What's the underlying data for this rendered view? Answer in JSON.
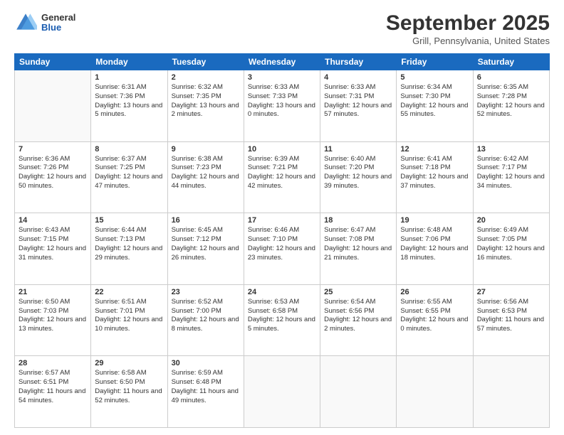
{
  "header": {
    "logo": {
      "general": "General",
      "blue": "Blue"
    },
    "title": "September 2025",
    "location": "Grill, Pennsylvania, United States"
  },
  "weekdays": [
    "Sunday",
    "Monday",
    "Tuesday",
    "Wednesday",
    "Thursday",
    "Friday",
    "Saturday"
  ],
  "weeks": [
    [
      {
        "day": "",
        "empty": true
      },
      {
        "day": "1",
        "sunrise": "Sunrise: 6:31 AM",
        "sunset": "Sunset: 7:36 PM",
        "daylight": "Daylight: 13 hours and 5 minutes."
      },
      {
        "day": "2",
        "sunrise": "Sunrise: 6:32 AM",
        "sunset": "Sunset: 7:35 PM",
        "daylight": "Daylight: 13 hours and 2 minutes."
      },
      {
        "day": "3",
        "sunrise": "Sunrise: 6:33 AM",
        "sunset": "Sunset: 7:33 PM",
        "daylight": "Daylight: 13 hours and 0 minutes."
      },
      {
        "day": "4",
        "sunrise": "Sunrise: 6:33 AM",
        "sunset": "Sunset: 7:31 PM",
        "daylight": "Daylight: 12 hours and 57 minutes."
      },
      {
        "day": "5",
        "sunrise": "Sunrise: 6:34 AM",
        "sunset": "Sunset: 7:30 PM",
        "daylight": "Daylight: 12 hours and 55 minutes."
      },
      {
        "day": "6",
        "sunrise": "Sunrise: 6:35 AM",
        "sunset": "Sunset: 7:28 PM",
        "daylight": "Daylight: 12 hours and 52 minutes."
      }
    ],
    [
      {
        "day": "7",
        "sunrise": "Sunrise: 6:36 AM",
        "sunset": "Sunset: 7:26 PM",
        "daylight": "Daylight: 12 hours and 50 minutes."
      },
      {
        "day": "8",
        "sunrise": "Sunrise: 6:37 AM",
        "sunset": "Sunset: 7:25 PM",
        "daylight": "Daylight: 12 hours and 47 minutes."
      },
      {
        "day": "9",
        "sunrise": "Sunrise: 6:38 AM",
        "sunset": "Sunset: 7:23 PM",
        "daylight": "Daylight: 12 hours and 44 minutes."
      },
      {
        "day": "10",
        "sunrise": "Sunrise: 6:39 AM",
        "sunset": "Sunset: 7:21 PM",
        "daylight": "Daylight: 12 hours and 42 minutes."
      },
      {
        "day": "11",
        "sunrise": "Sunrise: 6:40 AM",
        "sunset": "Sunset: 7:20 PM",
        "daylight": "Daylight: 12 hours and 39 minutes."
      },
      {
        "day": "12",
        "sunrise": "Sunrise: 6:41 AM",
        "sunset": "Sunset: 7:18 PM",
        "daylight": "Daylight: 12 hours and 37 minutes."
      },
      {
        "day": "13",
        "sunrise": "Sunrise: 6:42 AM",
        "sunset": "Sunset: 7:17 PM",
        "daylight": "Daylight: 12 hours and 34 minutes."
      }
    ],
    [
      {
        "day": "14",
        "sunrise": "Sunrise: 6:43 AM",
        "sunset": "Sunset: 7:15 PM",
        "daylight": "Daylight: 12 hours and 31 minutes."
      },
      {
        "day": "15",
        "sunrise": "Sunrise: 6:44 AM",
        "sunset": "Sunset: 7:13 PM",
        "daylight": "Daylight: 12 hours and 29 minutes."
      },
      {
        "day": "16",
        "sunrise": "Sunrise: 6:45 AM",
        "sunset": "Sunset: 7:12 PM",
        "daylight": "Daylight: 12 hours and 26 minutes."
      },
      {
        "day": "17",
        "sunrise": "Sunrise: 6:46 AM",
        "sunset": "Sunset: 7:10 PM",
        "daylight": "Daylight: 12 hours and 23 minutes."
      },
      {
        "day": "18",
        "sunrise": "Sunrise: 6:47 AM",
        "sunset": "Sunset: 7:08 PM",
        "daylight": "Daylight: 12 hours and 21 minutes."
      },
      {
        "day": "19",
        "sunrise": "Sunrise: 6:48 AM",
        "sunset": "Sunset: 7:06 PM",
        "daylight": "Daylight: 12 hours and 18 minutes."
      },
      {
        "day": "20",
        "sunrise": "Sunrise: 6:49 AM",
        "sunset": "Sunset: 7:05 PM",
        "daylight": "Daylight: 12 hours and 16 minutes."
      }
    ],
    [
      {
        "day": "21",
        "sunrise": "Sunrise: 6:50 AM",
        "sunset": "Sunset: 7:03 PM",
        "daylight": "Daylight: 12 hours and 13 minutes."
      },
      {
        "day": "22",
        "sunrise": "Sunrise: 6:51 AM",
        "sunset": "Sunset: 7:01 PM",
        "daylight": "Daylight: 12 hours and 10 minutes."
      },
      {
        "day": "23",
        "sunrise": "Sunrise: 6:52 AM",
        "sunset": "Sunset: 7:00 PM",
        "daylight": "Daylight: 12 hours and 8 minutes."
      },
      {
        "day": "24",
        "sunrise": "Sunrise: 6:53 AM",
        "sunset": "Sunset: 6:58 PM",
        "daylight": "Daylight: 12 hours and 5 minutes."
      },
      {
        "day": "25",
        "sunrise": "Sunrise: 6:54 AM",
        "sunset": "Sunset: 6:56 PM",
        "daylight": "Daylight: 12 hours and 2 minutes."
      },
      {
        "day": "26",
        "sunrise": "Sunrise: 6:55 AM",
        "sunset": "Sunset: 6:55 PM",
        "daylight": "Daylight: 12 hours and 0 minutes."
      },
      {
        "day": "27",
        "sunrise": "Sunrise: 6:56 AM",
        "sunset": "Sunset: 6:53 PM",
        "daylight": "Daylight: 11 hours and 57 minutes."
      }
    ],
    [
      {
        "day": "28",
        "sunrise": "Sunrise: 6:57 AM",
        "sunset": "Sunset: 6:51 PM",
        "daylight": "Daylight: 11 hours and 54 minutes."
      },
      {
        "day": "29",
        "sunrise": "Sunrise: 6:58 AM",
        "sunset": "Sunset: 6:50 PM",
        "daylight": "Daylight: 11 hours and 52 minutes."
      },
      {
        "day": "30",
        "sunrise": "Sunrise: 6:59 AM",
        "sunset": "Sunset: 6:48 PM",
        "daylight": "Daylight: 11 hours and 49 minutes."
      },
      {
        "day": "",
        "empty": true
      },
      {
        "day": "",
        "empty": true
      },
      {
        "day": "",
        "empty": true
      },
      {
        "day": "",
        "empty": true
      }
    ]
  ]
}
